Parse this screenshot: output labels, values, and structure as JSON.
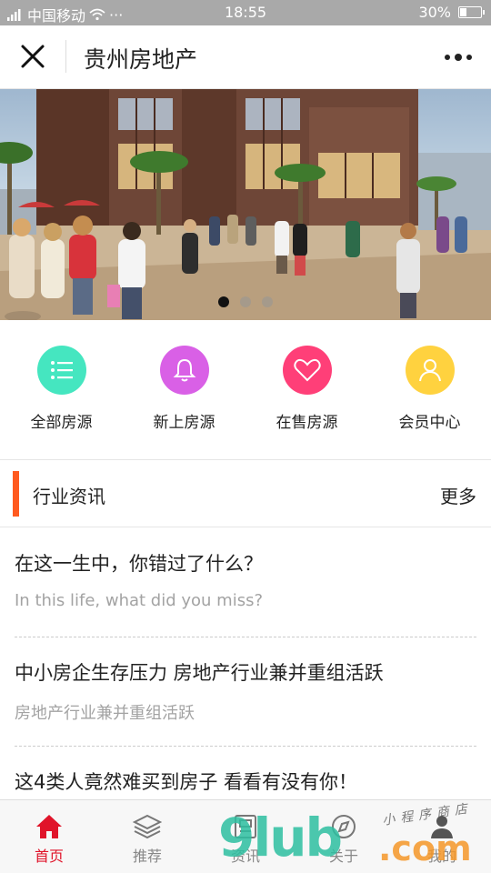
{
  "status_bar": {
    "carrier": "中国移动",
    "dots": "···",
    "time": "18:55",
    "battery": "30%",
    "battery_level": 0.3
  },
  "header": {
    "title": "贵州房地产",
    "close_icon": "close-icon",
    "more_icon": "more-icon"
  },
  "banner": {
    "slide_count": 3,
    "active_index": 0
  },
  "quick_nav": [
    {
      "label": "全部房源",
      "icon": "list-icon",
      "color": "#45e6c0"
    },
    {
      "label": "新上房源",
      "icon": "bell-icon",
      "color": "#d960e6"
    },
    {
      "label": "在售房源",
      "icon": "heart-icon",
      "color": "#ff3f78"
    },
    {
      "label": "会员中心",
      "icon": "user-icon",
      "color": "#ffd23f"
    }
  ],
  "section": {
    "title": "行业资讯",
    "more": "更多",
    "accent_color": "#ff5a1f"
  },
  "news": [
    {
      "title": "在这一生中，你错过了什么？",
      "subtitle": "In this life, what did you miss?"
    },
    {
      "title": "中小房企生存压力 房地产行业兼并重组活跃",
      "subtitle": "房地产行业兼并重组活跃"
    },
    {
      "title": "这4类人竟然难买到房子 看看有没有你！",
      "subtitle": ""
    }
  ],
  "tabs": [
    {
      "label": "首页",
      "icon": "home-icon",
      "active": true
    },
    {
      "label": "推荐",
      "icon": "layers-icon",
      "active": false
    },
    {
      "label": "资讯",
      "icon": "news-icon",
      "active": false
    },
    {
      "label": "关于",
      "icon": "compass-icon",
      "active": false
    },
    {
      "label": "我的",
      "icon": "person-icon",
      "active": false
    }
  ],
  "watermark": {
    "main": "9lub",
    "domain": ".com",
    "tagline": "小程序商店"
  }
}
